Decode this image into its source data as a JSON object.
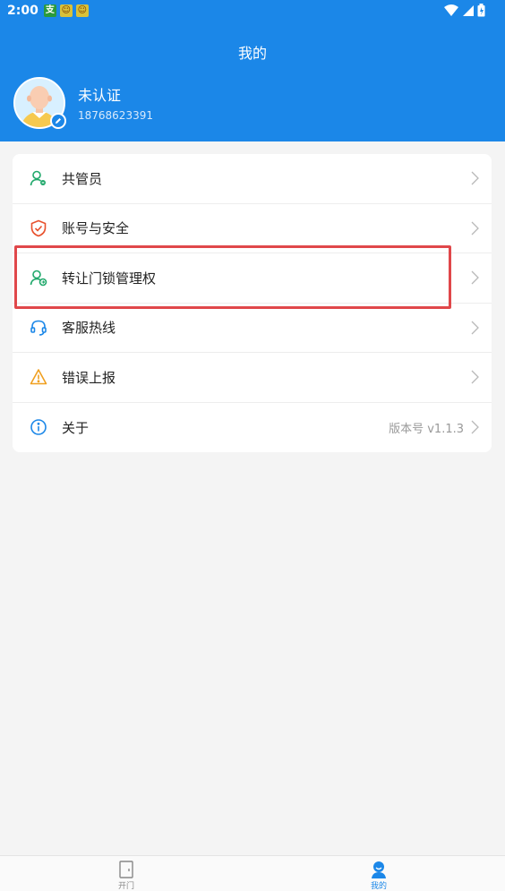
{
  "status_bar": {
    "time": "2:00",
    "notification_icons": [
      "app-notification-icon",
      "app-notification-icon",
      "app-notification-icon"
    ],
    "system_icons": [
      "wifi-icon",
      "signal-icon",
      "battery-icon"
    ]
  },
  "header": {
    "title": "我的",
    "background_color": "#1b87e8"
  },
  "profile": {
    "name": "未认证",
    "phone": "18768623391",
    "avatar_icon": "avatar-icon",
    "edit_icon": "edit-icon"
  },
  "menu": {
    "items": [
      {
        "label": "共管员",
        "icon": "user-icon",
        "icon_color": "#20a86b"
      },
      {
        "label": "账号与安全",
        "icon": "shield-check-icon",
        "icon_color": "#e8512d"
      },
      {
        "label": "转让门锁管理权",
        "icon": "user-transfer-icon",
        "icon_color": "#20a86b"
      },
      {
        "label": "客服热线",
        "icon": "headset-icon",
        "icon_color": "#1b87e8"
      },
      {
        "label": "错误上报",
        "icon": "warning-icon",
        "icon_color": "#f0a020"
      },
      {
        "label": "关于",
        "icon": "info-icon",
        "icon_color": "#1b87e8",
        "extra": "版本号 v1.1.3"
      }
    ]
  },
  "tabbar": {
    "tabs": [
      {
        "label": "开门",
        "icon": "door-icon",
        "active": false
      },
      {
        "label": "我的",
        "icon": "profile-icon",
        "active": true
      }
    ]
  }
}
